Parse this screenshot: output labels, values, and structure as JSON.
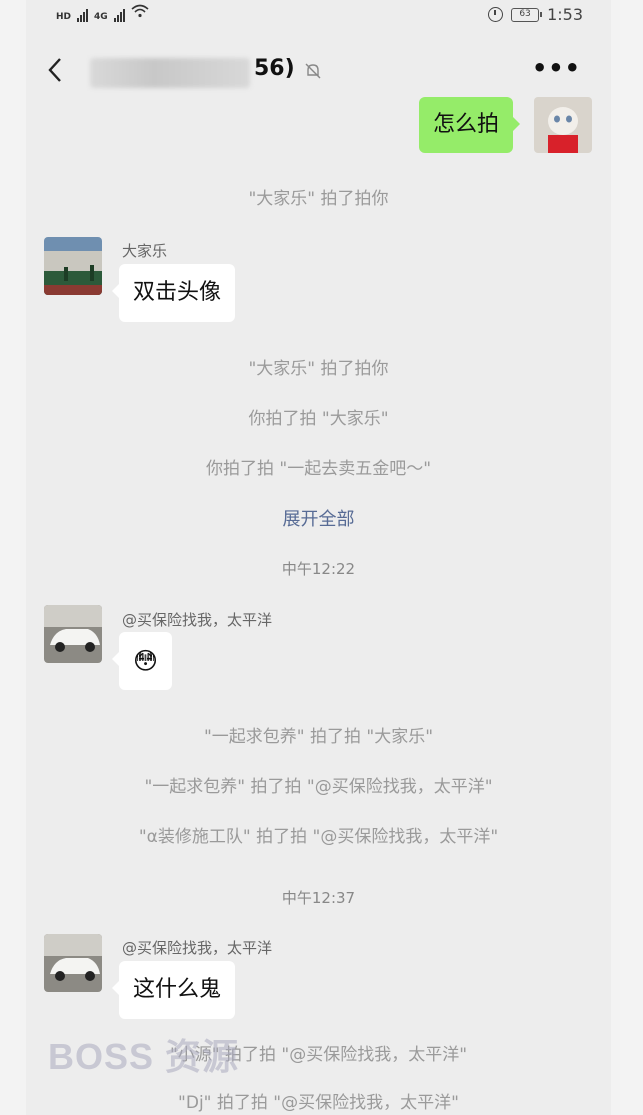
{
  "status_bar": {
    "left_badges": [
      "HD",
      "4G",
      "4G"
    ],
    "battery": "63",
    "time": "1:53"
  },
  "nav": {
    "title_suffix": "56)",
    "more_label": "•••"
  },
  "messages": {
    "me_1": "怎么拍",
    "dajiale_nick": "大家乐",
    "dajiale_text": "双击头像",
    "insure_nick_1": "@买保险找我，太平洋",
    "insure_emoji": "😳",
    "insure_nick_2": "@买保险找我，太平洋",
    "insure_text": "这什么鬼"
  },
  "system": {
    "s1": "\"大家乐\" 拍了拍你",
    "s2": "\"大家乐\" 拍了拍你",
    "s3": "你拍了拍 \"大家乐\"",
    "s4": "你拍了拍 \"一起去卖五金吧～\"",
    "expand": "展开全部",
    "time1": "中午12:22",
    "s5": "\"一起求包养\" 拍了拍 \"大家乐\"",
    "s6": "\"一起求包养\" 拍了拍 \"@买保险找我，太平洋\"",
    "s7": "\"α装修施工队\" 拍了拍 \"@买保险找我，太平洋\"",
    "time2": "中午12:37",
    "s8": "\"小源\" 拍了拍 \"@买保险找我，太平洋\"",
    "s9": "\"Dj\" 拍了拍 \"@买保险找我，太平洋\""
  },
  "watermark": "BOSS 资源",
  "colors": {
    "background": "#ededed",
    "my_bubble": "#95ec69",
    "link": "#576b95"
  }
}
